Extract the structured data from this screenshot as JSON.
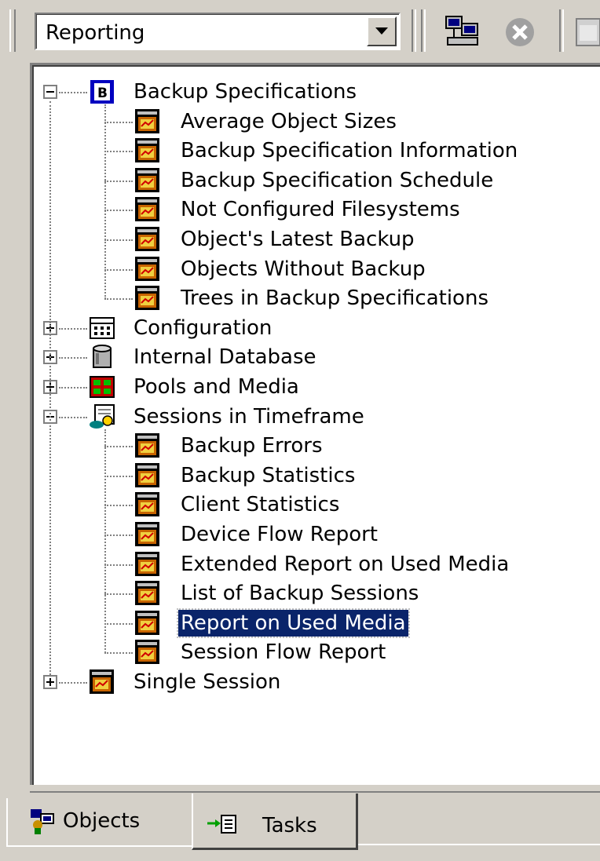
{
  "toolbar": {
    "context_value": "Reporting",
    "buttons": [
      {
        "icon": "network-computers-icon"
      },
      {
        "icon": "stop-icon"
      },
      {
        "icon": "calendar-icon"
      }
    ]
  },
  "tree": {
    "groups": [
      {
        "label": "Backup Specifications",
        "expanded": true,
        "icon": "backup-spec-icon",
        "items": [
          "Average Object Sizes",
          "Backup Specification Information",
          "Backup Specification Schedule",
          "Not Configured Filesystems",
          "Object's Latest Backup",
          "Objects Without Backup",
          "Trees in Backup Specifications"
        ]
      },
      {
        "label": "Configuration",
        "expanded": false,
        "icon": "configuration-icon",
        "items": []
      },
      {
        "label": "Internal Database",
        "expanded": false,
        "icon": "database-icon",
        "items": []
      },
      {
        "label": "Pools and Media",
        "expanded": false,
        "icon": "pools-media-icon",
        "items": []
      },
      {
        "label": "Sessions in Timeframe",
        "expanded": true,
        "icon": "sessions-timeframe-icon",
        "items": [
          "Backup Errors",
          "Backup Statistics",
          "Client Statistics",
          "Device Flow Report",
          "Extended Report on Used Media",
          "List of Backup Sessions",
          "Report on Used Media",
          "Session Flow Report"
        ]
      },
      {
        "label": "Single Session",
        "expanded": false,
        "icon": "report-icon",
        "items": []
      }
    ],
    "selected": "Report on Used Media"
  },
  "tabs": [
    {
      "label": "Objects",
      "icon": "objects-icon",
      "active": false
    },
    {
      "label": "Tasks",
      "icon": "tasks-icon",
      "active": true
    }
  ],
  "colors": {
    "selection": "#0a246a",
    "window": "#d4d0c8"
  }
}
